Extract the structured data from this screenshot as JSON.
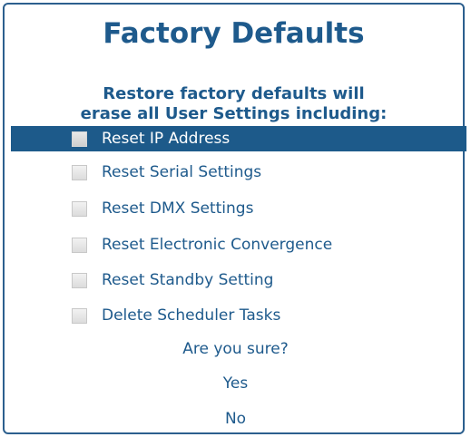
{
  "dialog": {
    "title": "Factory Defaults",
    "subtitle_line1": "Restore factory defaults will",
    "subtitle_line2": "erase all User Settings including:"
  },
  "options": [
    {
      "label": "Reset IP Address",
      "checked": false,
      "selected": true
    },
    {
      "label": "Reset Serial Settings",
      "checked": false,
      "selected": false
    },
    {
      "label": "Reset DMX Settings",
      "checked": false,
      "selected": false
    },
    {
      "label": "Reset Electronic Convergence",
      "checked": false,
      "selected": false
    },
    {
      "label": "Reset Standby Setting",
      "checked": false,
      "selected": false
    },
    {
      "label": "Delete Scheduler Tasks",
      "checked": false,
      "selected": false
    }
  ],
  "confirm": {
    "question": "Are you sure?",
    "yes_label": "Yes",
    "no_label": "No"
  },
  "colors": {
    "accent": "#1e5a8c",
    "selection_bg": "#1d5a8a",
    "border": "#2c5f8e"
  }
}
